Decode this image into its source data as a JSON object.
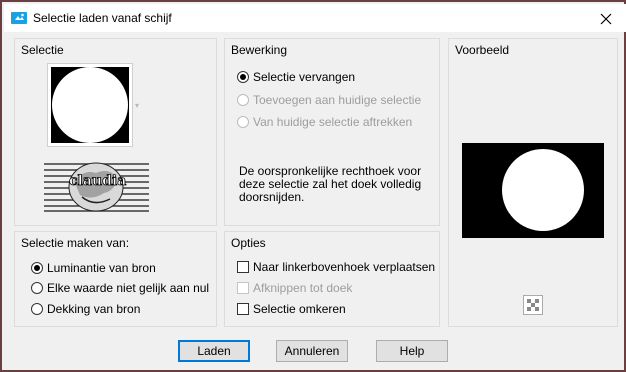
{
  "window": {
    "title": "Selectie laden vanaf schijf"
  },
  "selectie": {
    "title": "Selectie",
    "thumbnail_text": "claudia"
  },
  "bewerking": {
    "title": "Bewerking",
    "options": [
      {
        "label": "Selectie vervangen",
        "checked": true,
        "enabled": true
      },
      {
        "label": "Toevoegen aan huidige selectie",
        "checked": false,
        "enabled": false
      },
      {
        "label": "Van huidige selectie aftrekken",
        "checked": false,
        "enabled": false
      }
    ],
    "description": "De oorspronkelijke rechthoek voor deze selectie zal het doek volledig doorsnijden."
  },
  "voorbeeld": {
    "title": "Voorbeeld"
  },
  "maken_van": {
    "title": "Selectie maken van:",
    "options": [
      {
        "label": "Luminantie van bron",
        "checked": true
      },
      {
        "label": "Elke waarde niet gelijk aan nul",
        "checked": false
      },
      {
        "label": "Dekking van bron",
        "checked": false
      }
    ]
  },
  "opties": {
    "title": "Opties",
    "items": [
      {
        "label": "Naar linkerbovenhoek verplaatsen",
        "checked": false,
        "enabled": true
      },
      {
        "label": "Afknippen tot doek",
        "checked": false,
        "enabled": false
      },
      {
        "label": "Selectie omkeren",
        "checked": false,
        "enabled": true
      }
    ]
  },
  "buttons": {
    "load": "Laden",
    "cancel": "Annuleren",
    "help": "Help"
  },
  "colors": {
    "frame_border": "#6b3f3f",
    "accent": "#0078d7",
    "app_icon": "#1ba1e2"
  }
}
